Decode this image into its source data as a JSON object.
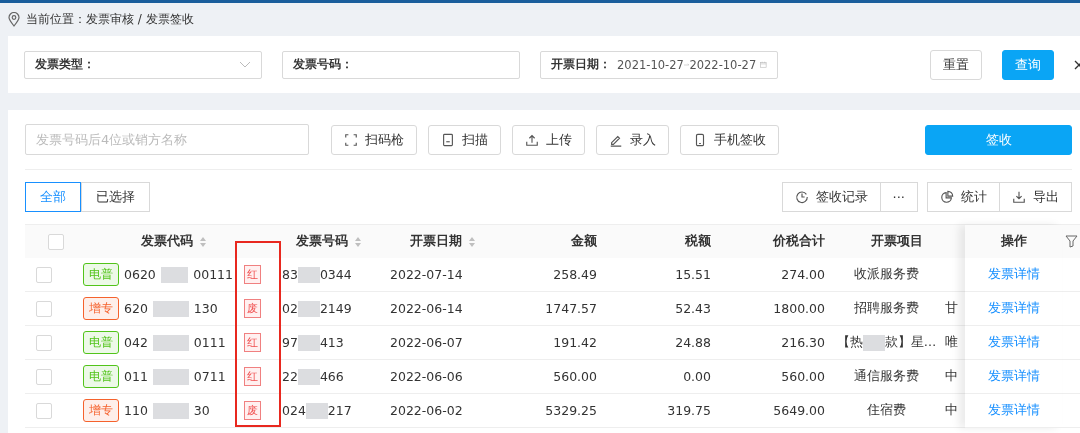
{
  "breadcrumb": {
    "label": "当前位置：",
    "path": [
      "发票审核",
      "发票签收"
    ],
    "separator": "/"
  },
  "filters": [
    {
      "label": "发票类型：",
      "kind": "select"
    },
    {
      "label": "发票号码：",
      "kind": "text"
    },
    {
      "label": "开票日期：",
      "kind": "daterange",
      "from": "2021-10-27",
      "to": "2022-10-27"
    }
  ],
  "filter_buttons": [
    "重置",
    "查询"
  ],
  "search": {
    "placeholder": "发票号码后4位或销方名称"
  },
  "actions": [
    "扫码枪",
    "扫描",
    "上传",
    "录入",
    "手机签收"
  ],
  "sign_button": "签收",
  "tabs": [
    {
      "label": "全部",
      "selected": true
    },
    {
      "label": "已选择",
      "selected": false
    }
  ],
  "tools": [
    "签收记录",
    "···",
    "统计",
    "导出"
  ],
  "table": {
    "select_all_checked": false,
    "columns": [
      {
        "label": "发票代码",
        "sortable": true
      },
      {
        "label": "发票号码",
        "sortable": true
      },
      {
        "label": "开票日期",
        "sortable": true
      },
      {
        "label": "金额",
        "sortable": false
      },
      {
        "label": "税额",
        "sortable": false
      },
      {
        "label": "价税合计",
        "sortable": false
      },
      {
        "label": "开票项目",
        "sortable": false
      },
      {
        "label": "操作",
        "sortable": false
      }
    ],
    "rows": [
      {
        "checked": false,
        "type_tag": "电普",
        "color": "#52c41a",
        "code_head": "0620",
        "code_tail": "00111",
        "flag": "红",
        "number_head": "83",
        "number_tail": "0344",
        "date": "2022-07-14",
        "amount": "258.49",
        "tax": "15.51",
        "total": "274.00",
        "item": [
          "收派服务费"
        ],
        "column_9": "",
        "action": "发票详情"
      },
      {
        "checked": false,
        "type_tag": "增专",
        "color": "#f5622d",
        "code_head": "620",
        "code_tail": "130",
        "flag": "废",
        "number_head": "02",
        "number_tail": "2149",
        "date": "2022-06-14",
        "amount": "1747.57",
        "tax": "52.43",
        "total": "1800.00",
        "item": [
          "招聘服务费"
        ],
        "column_9": "甘",
        "action": "发票详情"
      },
      {
        "checked": false,
        "type_tag": "电普",
        "color": "#52c41a",
        "code_head": "042",
        "code_tail": "0111",
        "flag": "红",
        "number_head": "97",
        "number_tail": "413",
        "date": "2022-06-07",
        "amount": "191.42",
        "tax": "24.88",
        "total": "216.30",
        "item": [
          "【热",
          "款】星…"
        ],
        "column_9": "唯",
        "action": "发票详情"
      },
      {
        "checked": false,
        "type_tag": "电普",
        "color": "#52c41a",
        "code_head": "011",
        "code_tail": "0711",
        "flag": "红",
        "number_head": "22",
        "number_tail": "466",
        "date": "2022-06-06",
        "amount": "560.00",
        "tax": "0.00",
        "total": "560.00",
        "item": [
          "通信服务费"
        ],
        "column_9": "中",
        "action": "发票详情"
      },
      {
        "checked": false,
        "type_tag": "增专",
        "color": "#f5622d",
        "code_head": "110",
        "code_tail": "30",
        "flag": "废",
        "number_head": "024",
        "number_tail": "217",
        "date": "2022-06-02",
        "amount": "5329.25",
        "tax": "319.75",
        "total": "5649.00",
        "item": [
          "住宿费"
        ],
        "column_9": "中",
        "action": "发票详情"
      }
    ]
  }
}
